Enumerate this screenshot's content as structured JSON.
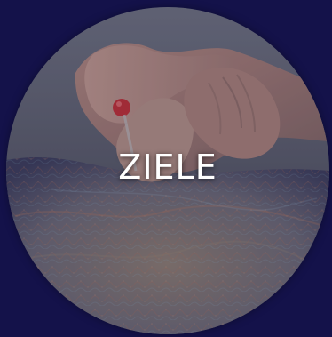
{
  "tile": {
    "title": "ZIELE",
    "background_color": "#14124a",
    "image_semantic": "hand-pinning-map-photo",
    "text_color": "#ffffff"
  }
}
